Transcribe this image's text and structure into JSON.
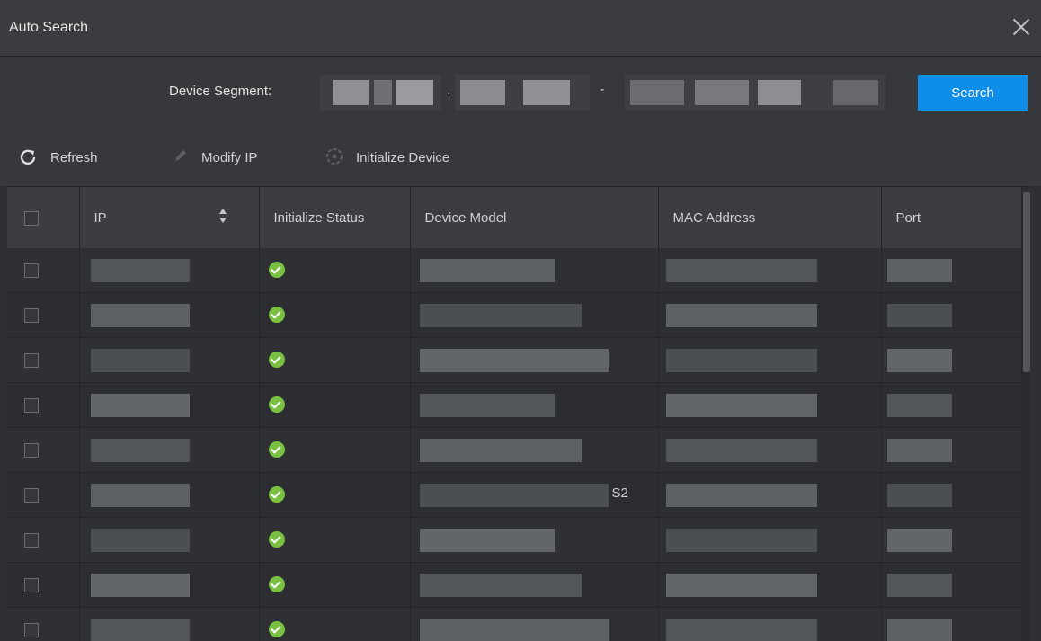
{
  "window": {
    "title": "Auto Search"
  },
  "segment": {
    "label": "Device Segment:",
    "separator_dot": "·",
    "separator_dash": "-",
    "search_label": "Search"
  },
  "toolbar": {
    "refresh_label": "Refresh",
    "modify_ip_label": "Modify IP",
    "initialize_label": "Initialize Device"
  },
  "table": {
    "columns": [
      "IP",
      "Initialize Status",
      "Device Model",
      "MAC Address",
      "Port"
    ],
    "rows": [
      {
        "model_suffix": ""
      },
      {
        "model_suffix": ""
      },
      {
        "model_suffix": ""
      },
      {
        "model_suffix": ""
      },
      {
        "model_suffix": ""
      },
      {
        "model_suffix": "S2"
      },
      {
        "model_suffix": ""
      },
      {
        "model_suffix": ""
      },
      {
        "model_suffix": ""
      }
    ]
  },
  "icons": {
    "close": "close-icon",
    "refresh": "refresh-icon",
    "edit": "pencil-icon",
    "init": "target-icon",
    "status": "check-circle-icon",
    "sort": "sort-icon"
  },
  "colors": {
    "accent": "#0e8ee9",
    "status_ok": "#7ac043",
    "titlebar": "#3a3c3f"
  }
}
